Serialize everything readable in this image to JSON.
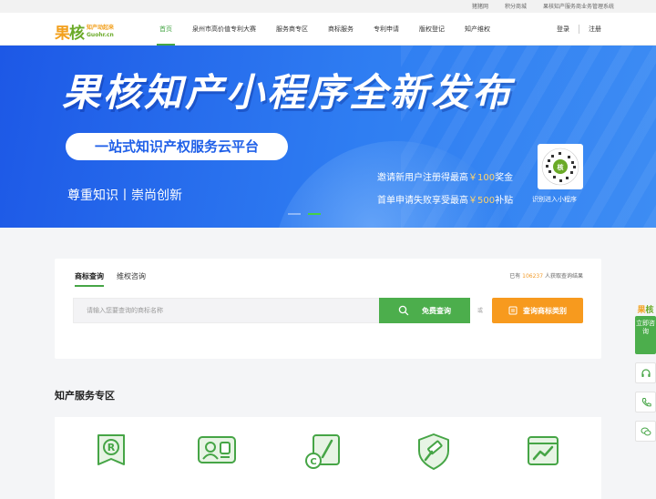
{
  "topbar": {
    "links": [
      "猪猪网",
      "积分商城",
      "果核知产服务商业务管理系统"
    ]
  },
  "nav": {
    "logo": {
      "mark_a": "果",
      "mark_b": "核",
      "tagline": "知产动起来",
      "domain": "Guohr.cn"
    },
    "menu": [
      "首页",
      "泉州市高价值专利大赛",
      "服务商专区",
      "商标服务",
      "专利申请",
      "版权登记",
      "知产维权"
    ],
    "active_index": 0,
    "login": "登录",
    "register": "注册"
  },
  "banner": {
    "title": "果核知产小程序全新发布",
    "pill": "一站式知识产权服务云平台",
    "slogan": "尊重知识丨崇尚创新",
    "promo1_pre": "邀请新用户注册得最高",
    "promo1_hl": "￥100",
    "promo1_post": "奖金",
    "promo2_pre": "首单申请失败享受最高",
    "promo2_hl": "￥500",
    "promo2_post": "补贴",
    "qr_caption": "识别进入小程序",
    "active_slide": 1
  },
  "search": {
    "tabs": [
      "商标查询",
      "维权咨询"
    ],
    "active_tab": 0,
    "counter_pre": "已有",
    "counter_num": "106237",
    "counter_post": "人获取查询结果",
    "placeholder": "请输入您要查询的商标名称",
    "search_button": "免费查询",
    "or_text": "或",
    "category_button": "查询商标类别"
  },
  "section": {
    "title": "知产服务专区"
  },
  "services": [
    {
      "icon": "trademark-icon"
    },
    {
      "icon": "portrait-stamp-icon"
    },
    {
      "icon": "copyright-icon"
    },
    {
      "icon": "shield-hammer-icon"
    },
    {
      "icon": "chart-trend-icon"
    }
  ],
  "sidebar": {
    "logo_a": "果",
    "logo_b": "核",
    "consult": "立即咨询",
    "icons": [
      "headset-icon",
      "phone-icon",
      "wechat-icon"
    ]
  },
  "colors": {
    "brand_green": "#46a546",
    "brand_orange": "#f79a1e",
    "banner_blue": "#2f7ef2"
  }
}
